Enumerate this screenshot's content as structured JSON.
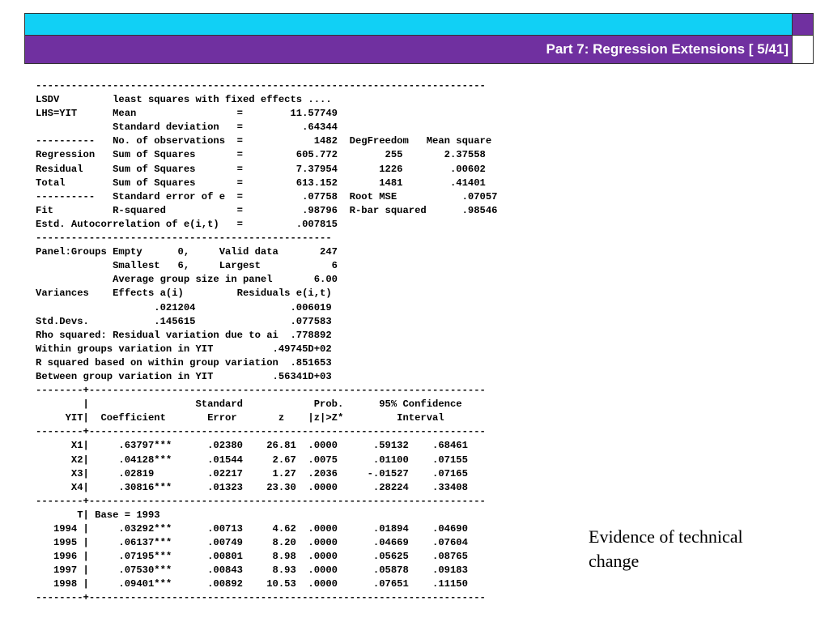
{
  "header": {
    "title": "Part 7: Regression Extensions [ 5/41]",
    "accent_cyan": "#11d0f5",
    "accent_purple": "#7030a0"
  },
  "output_lines": [
    "----------------------------------------------------------------------------",
    "LSDV         least squares with fixed effects ....",
    "LHS=YIT      Mean                 =        11.57749",
    "             Standard deviation   =          .64344",
    "----------   No. of observations  =            1482  DegFreedom   Mean square",
    "Regression   Sum of Squares       =         605.772        255       2.37558",
    "Residual     Sum of Squares       =         7.37954       1226        .00602",
    "Total        Sum of Squares       =         613.152       1481        .41401",
    "----------   Standard error of e  =          .07758  Root MSE           .07057",
    "Fit          R-squared            =          .98796  R-bar squared      .98546",
    "Estd. Autocorrelation of e(i,t)   =         .007815",
    "--------------------------------------------------",
    "Panel:Groups Empty      0,     Valid data       247",
    "             Smallest   6,     Largest            6",
    "             Average group size in panel       6.00",
    "Variances    Effects a(i)         Residuals e(i,t)",
    "                    .021204                .006019",
    "Std.Devs.           .145615                .077583",
    "Rho squared: Residual variation due to ai  .778892",
    "Within groups variation in YIT          .49745D+02",
    "R squared based on within group variation  .851653",
    "Between group variation in YIT          .56341D+03",
    "--------+-------------------------------------------------------------------",
    "        |                  Standard            Prob.      95% Confidence",
    "     YIT|  Coefficient       Error       z    |z|>Z*         Interval",
    "--------+-------------------------------------------------------------------",
    "      X1|     .63797***      .02380    26.81  .0000      .59132    .68461",
    "      X2|     .04128***      .01544     2.67  .0075      .01100    .07155",
    "      X3|     .02819         .02217     1.27  .2036     -.01527    .07165",
    "      X4|     .30816***      .01323    23.30  .0000      .28224    .33408",
    "--------+-------------------------------------------------------------------",
    "       T| Base = 1993",
    "   1994 |     .03292***      .00713     4.62  .0000      .01894    .04690",
    "   1995 |     .06137***      .00749     8.20  .0000      .04669    .07604",
    "   1996 |     .07195***      .00801     8.98  .0000      .05625    .08765",
    "   1997 |     .07530***      .00843     8.93  .0000      .05878    .09183",
    "   1998 |     .09401***      .00892    10.53  .0000      .07651    .11150",
    "--------+-------------------------------------------------------------------"
  ],
  "annotation": {
    "line1": "Evidence of technical",
    "line2": "change"
  }
}
